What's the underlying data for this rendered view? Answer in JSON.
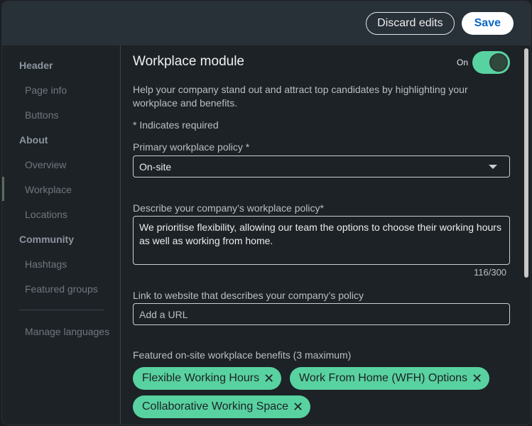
{
  "header": {
    "discard_label": "Discard edits",
    "save_label": "Save"
  },
  "sidebar": {
    "sections": [
      {
        "label": "Header",
        "items": [
          "Page info",
          "Buttons"
        ]
      },
      {
        "label": "About",
        "items": [
          "Overview",
          "Workplace",
          "Locations"
        ]
      },
      {
        "label": "Community",
        "items": [
          "Hashtags",
          "Featured groups"
        ]
      }
    ],
    "active_item": "Workplace",
    "footer_item": "Manage languages"
  },
  "module": {
    "title": "Workplace module",
    "toggle_label": "On",
    "toggle_on": true,
    "description": "Help your company stand out and attract top candidates by highlighting your workplace and benefits.",
    "required_note": "* Indicates required",
    "policy_label": "Primary workplace policy *",
    "policy_value": "On-site",
    "describe_label": "Describe your company’s workplace policy*",
    "describe_value": "We prioritise flexibility, allowing our team the options to choose their working hours as well as working from home.",
    "counter": "116/300",
    "link_label": "Link to website that describes your company’s policy",
    "link_placeholder": "Add a URL",
    "benefits_label": "Featured on-site workplace benefits (3 maximum)",
    "benefits": [
      "Flexible Working Hours",
      "Work From Home (WFH) Options",
      "Collaborative Working Space"
    ]
  },
  "colors": {
    "accent": "#58d2a0",
    "save_text": "#0a66c2",
    "background": "#1d2226"
  }
}
